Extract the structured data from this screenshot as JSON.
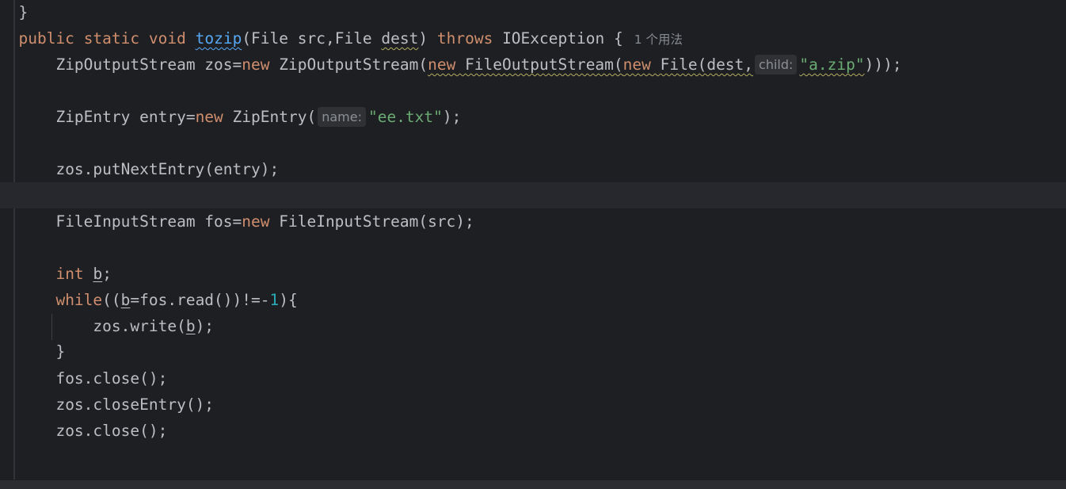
{
  "lines": {
    "l0": {
      "brace": "}"
    },
    "l1": {
      "kw_public": "public",
      "kw_static": "static",
      "kw_void": "void",
      "method": "tozip",
      "params_a": "(File src,File ",
      "param_dest": "dest",
      "params_b": ") ",
      "kw_throws": "throws",
      "exception": " IOException {",
      "usages": "1 个用法"
    },
    "l2": {
      "a": "ZipOutputStream zos=",
      "kw_new1": "new",
      "b": " ZipOutputStream(",
      "kw_new2": "new",
      "c": " FileOutputStream(",
      "kw_new3": "new",
      "d": " File(dest,",
      "hint": "child:",
      "str": "\"a.zip\"",
      "e": ")));"
    },
    "l4": {
      "a": "ZipEntry entry=",
      "kw_new": "new",
      "b": " ZipEntry(",
      "hint": "name:",
      "str": "\"ee.txt\"",
      "c": ");"
    },
    "l6": {
      "a": "zos.putNextEntry(entry);"
    },
    "l8": {
      "a": "FileInputStream fos=",
      "kw_new": "new",
      "b": " FileInputStream(src);"
    },
    "l10": {
      "kw_int": "int",
      "var": "b",
      "semi": ";"
    },
    "l11": {
      "kw_while": "while",
      "a": "((",
      "var": "b",
      "b": "=fos.read())!=-",
      "num": "1",
      "c": "){"
    },
    "l12": {
      "a": "zos.write(",
      "var": "b",
      "b": ");"
    },
    "l13": {
      "a": "}"
    },
    "l14": {
      "a": "fos.close();"
    },
    "l15": {
      "a": "zos.closeEntry();"
    },
    "l16": {
      "a": "zos.close();"
    }
  },
  "colors": {
    "background": "#1e1f22",
    "keyword": "#cf8e6d",
    "method": "#56a8f5",
    "string": "#6aab73",
    "number": "#2aacb8",
    "text": "#bcbec4"
  }
}
